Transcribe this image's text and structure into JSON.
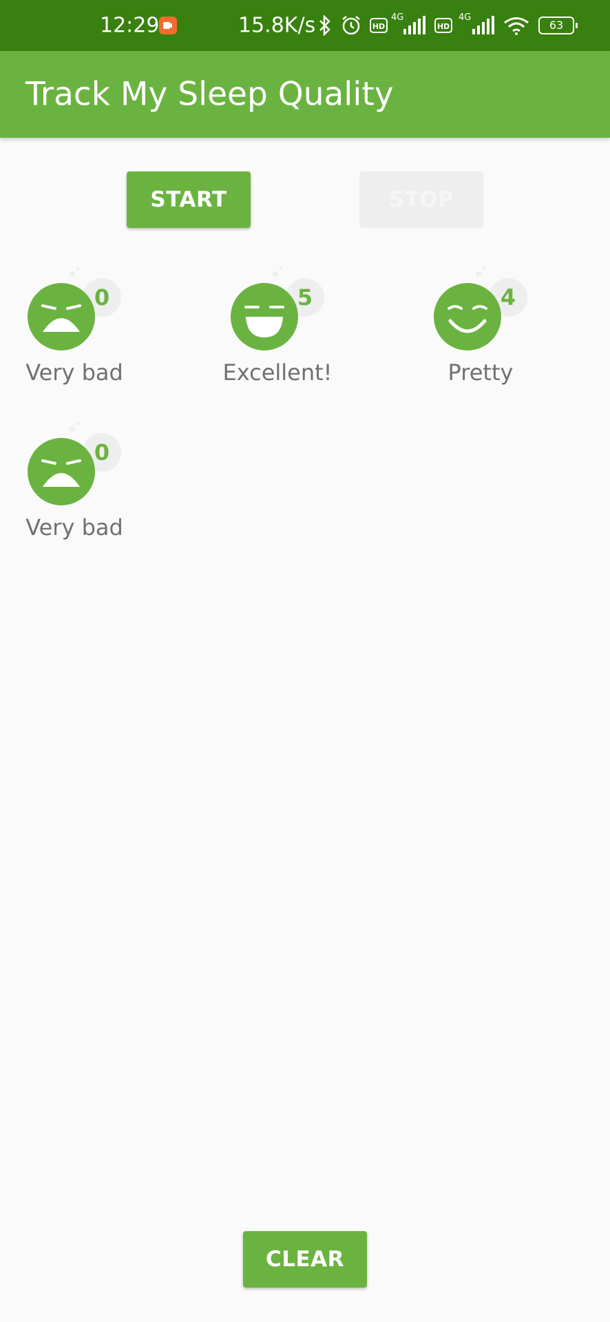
{
  "status_bar": {
    "time": "12:29",
    "net_speed": "15.8K/s",
    "hd_label": "HD",
    "network_type": "4G",
    "battery": "63"
  },
  "app_bar": {
    "title": "Track My Sleep Quality"
  },
  "buttons": {
    "start": "START",
    "stop": "STOP",
    "clear": "CLEAR"
  },
  "nights": [
    {
      "score": "0",
      "label": "Very bad",
      "face": "very-bad"
    },
    {
      "score": "5",
      "label": "Excellent!",
      "face": "excellent"
    },
    {
      "score": "4",
      "label": "Pretty",
      "face": "pretty"
    },
    {
      "score": "0",
      "label": "Very bad",
      "face": "very-bad"
    }
  ],
  "colors": {
    "status_bar": "#38800f",
    "app_bar": "#6bb340",
    "accent": "#6bb340",
    "background": "#fafafa",
    "label_text": "#707070",
    "score_bubble": "#eeeeee"
  }
}
